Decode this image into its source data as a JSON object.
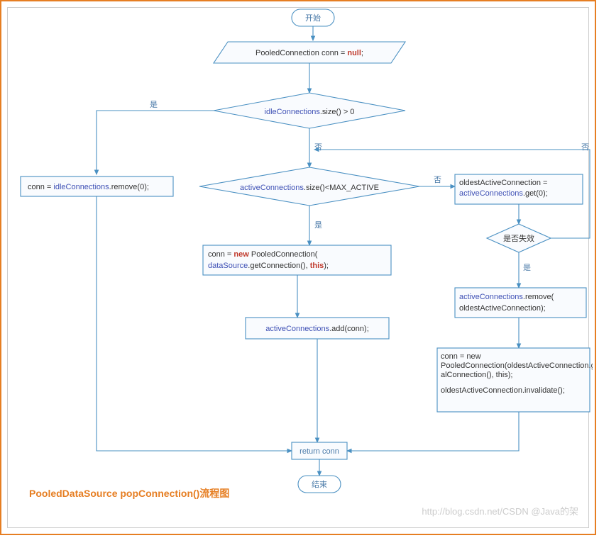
{
  "start": "开始",
  "end": "结束",
  "initConn": {
    "pre": "PooledConnection conn = ",
    "null": "null",
    "post": ";"
  },
  "decisionIdle": {
    "var": "idleConnections",
    "rest": ".size() > 0"
  },
  "yes": "是",
  "no": "否",
  "invalidLabel": "是否失效",
  "removeIdle": {
    "pre": "conn = ",
    "var": "idleConnections",
    "rest": ".remove(0);"
  },
  "decisionActive": {
    "var": "activeConnections",
    "rest": ".size()<MAX_ACTIVE"
  },
  "oldestAssign": {
    "l1a": "oldestActiveConnection =",
    "var": "activeConnections",
    "rest": ".get(0);"
  },
  "newPooled": {
    "l1a": "conn = ",
    "new": "new",
    "l1b": " PooledConnection(",
    "var": "dataSource",
    "l2a": ".getConnection(), ",
    "this": "this",
    "l2b": ");"
  },
  "addActive": {
    "var": "activeConnections",
    "rest": ".add(conn);"
  },
  "removeActive": {
    "var": "activeConnections",
    "l1b": ".remove(",
    "l2": "oldestActiveConnection);"
  },
  "block5": {
    "l1": "conn = new",
    "l2": "PooledConnection(oldestActiveConnection.getRe",
    "l3": "alConnection(), this);",
    "l4": "oldestActiveConnection.invalidate();"
  },
  "returnConn": "return conn",
  "title": "PooledDataSource popConnection()流程图",
  "watermark": "http://blog.csdn.net/CSDN @Java的架"
}
